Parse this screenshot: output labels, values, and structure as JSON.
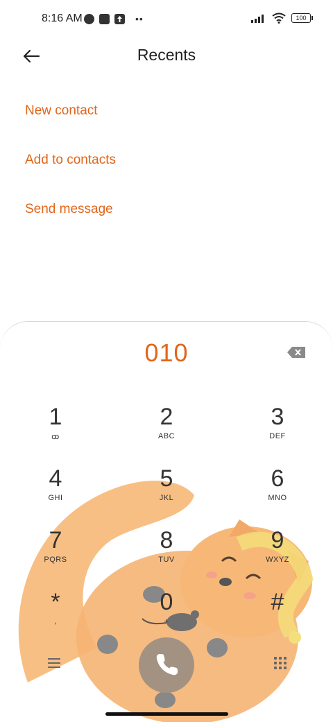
{
  "status_bar": {
    "time": "8:16 AM",
    "battery": "100",
    "icons": [
      "timer-icon",
      "square-notification-icon",
      "upload-icon",
      "more-dots-icon",
      "signal-icon",
      "wifi-icon",
      "battery-icon"
    ]
  },
  "header": {
    "title": "Recents",
    "back_icon": "arrow-left-icon"
  },
  "actions": [
    {
      "label": "New contact"
    },
    {
      "label": "Add to contacts"
    },
    {
      "label": "Send message"
    }
  ],
  "dialer": {
    "number": "010",
    "keys": [
      {
        "digit": "1",
        "letters": "ꝏ"
      },
      {
        "digit": "2",
        "letters": "ABC"
      },
      {
        "digit": "3",
        "letters": "DEF"
      },
      {
        "digit": "4",
        "letters": "GHI"
      },
      {
        "digit": "5",
        "letters": "JKL"
      },
      {
        "digit": "6",
        "letters": "MNO"
      },
      {
        "digit": "7",
        "letters": "PQRS"
      },
      {
        "digit": "8",
        "letters": "TUV"
      },
      {
        "digit": "9",
        "letters": "WXYZ"
      },
      {
        "digit": "*",
        "letters": ","
      },
      {
        "digit": "0",
        "letters": "+"
      },
      {
        "digit": "#",
        "letters": ""
      }
    ]
  },
  "colors": {
    "accent": "#e0661a",
    "call_button": "#a39282",
    "cat_fur": "#f7b877"
  }
}
